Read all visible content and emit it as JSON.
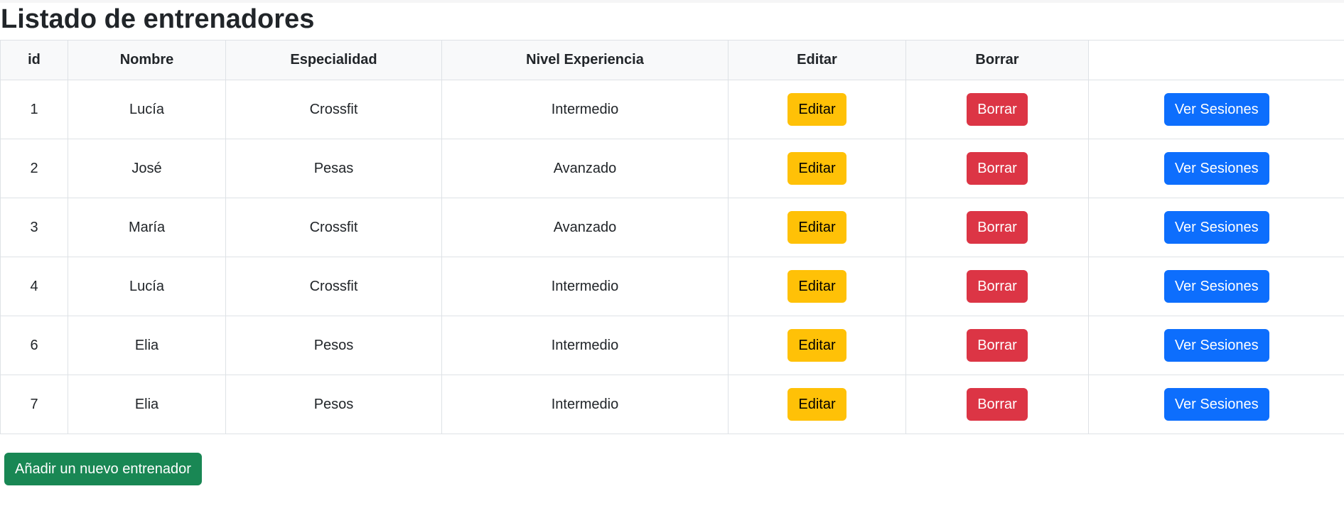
{
  "page": {
    "title": "Listado de entrenadores"
  },
  "table": {
    "headers": [
      "id",
      "Nombre",
      "Especialidad",
      "Nivel Experiencia",
      "Editar",
      "Borrar",
      ""
    ],
    "rows": [
      {
        "id": "1",
        "nombre": "Lucía",
        "especialidad": "Crossfit",
        "nivel": "Intermedio",
        "editar": "Editar",
        "borrar": "Borrar",
        "sesiones": "Ver Sesiones"
      },
      {
        "id": "2",
        "nombre": "José",
        "especialidad": "Pesas",
        "nivel": "Avanzado",
        "editar": "Editar",
        "borrar": "Borrar",
        "sesiones": "Ver Sesiones"
      },
      {
        "id": "3",
        "nombre": "María",
        "especialidad": "Crossfit",
        "nivel": "Avanzado",
        "editar": "Editar",
        "borrar": "Borrar",
        "sesiones": "Ver Sesiones"
      },
      {
        "id": "4",
        "nombre": "Lucía",
        "especialidad": "Crossfit",
        "nivel": "Intermedio",
        "editar": "Editar",
        "borrar": "Borrar",
        "sesiones": "Ver Sesiones"
      },
      {
        "id": "6",
        "nombre": "Elia",
        "especialidad": "Pesos",
        "nivel": "Intermedio",
        "editar": "Editar",
        "borrar": "Borrar",
        "sesiones": "Ver Sesiones"
      },
      {
        "id": "7",
        "nombre": "Elia",
        "especialidad": "Pesos",
        "nivel": "Intermedio",
        "editar": "Editar",
        "borrar": "Borrar",
        "sesiones": "Ver Sesiones"
      }
    ]
  },
  "actions": {
    "add_label": "Añadir un nuevo entrenador"
  },
  "colors": {
    "edit": "#ffc107",
    "delete": "#dc3545",
    "sessions": "#0d6efd",
    "add": "#198754",
    "header_bg": "#f8f9fa",
    "border": "#dee2e6"
  }
}
